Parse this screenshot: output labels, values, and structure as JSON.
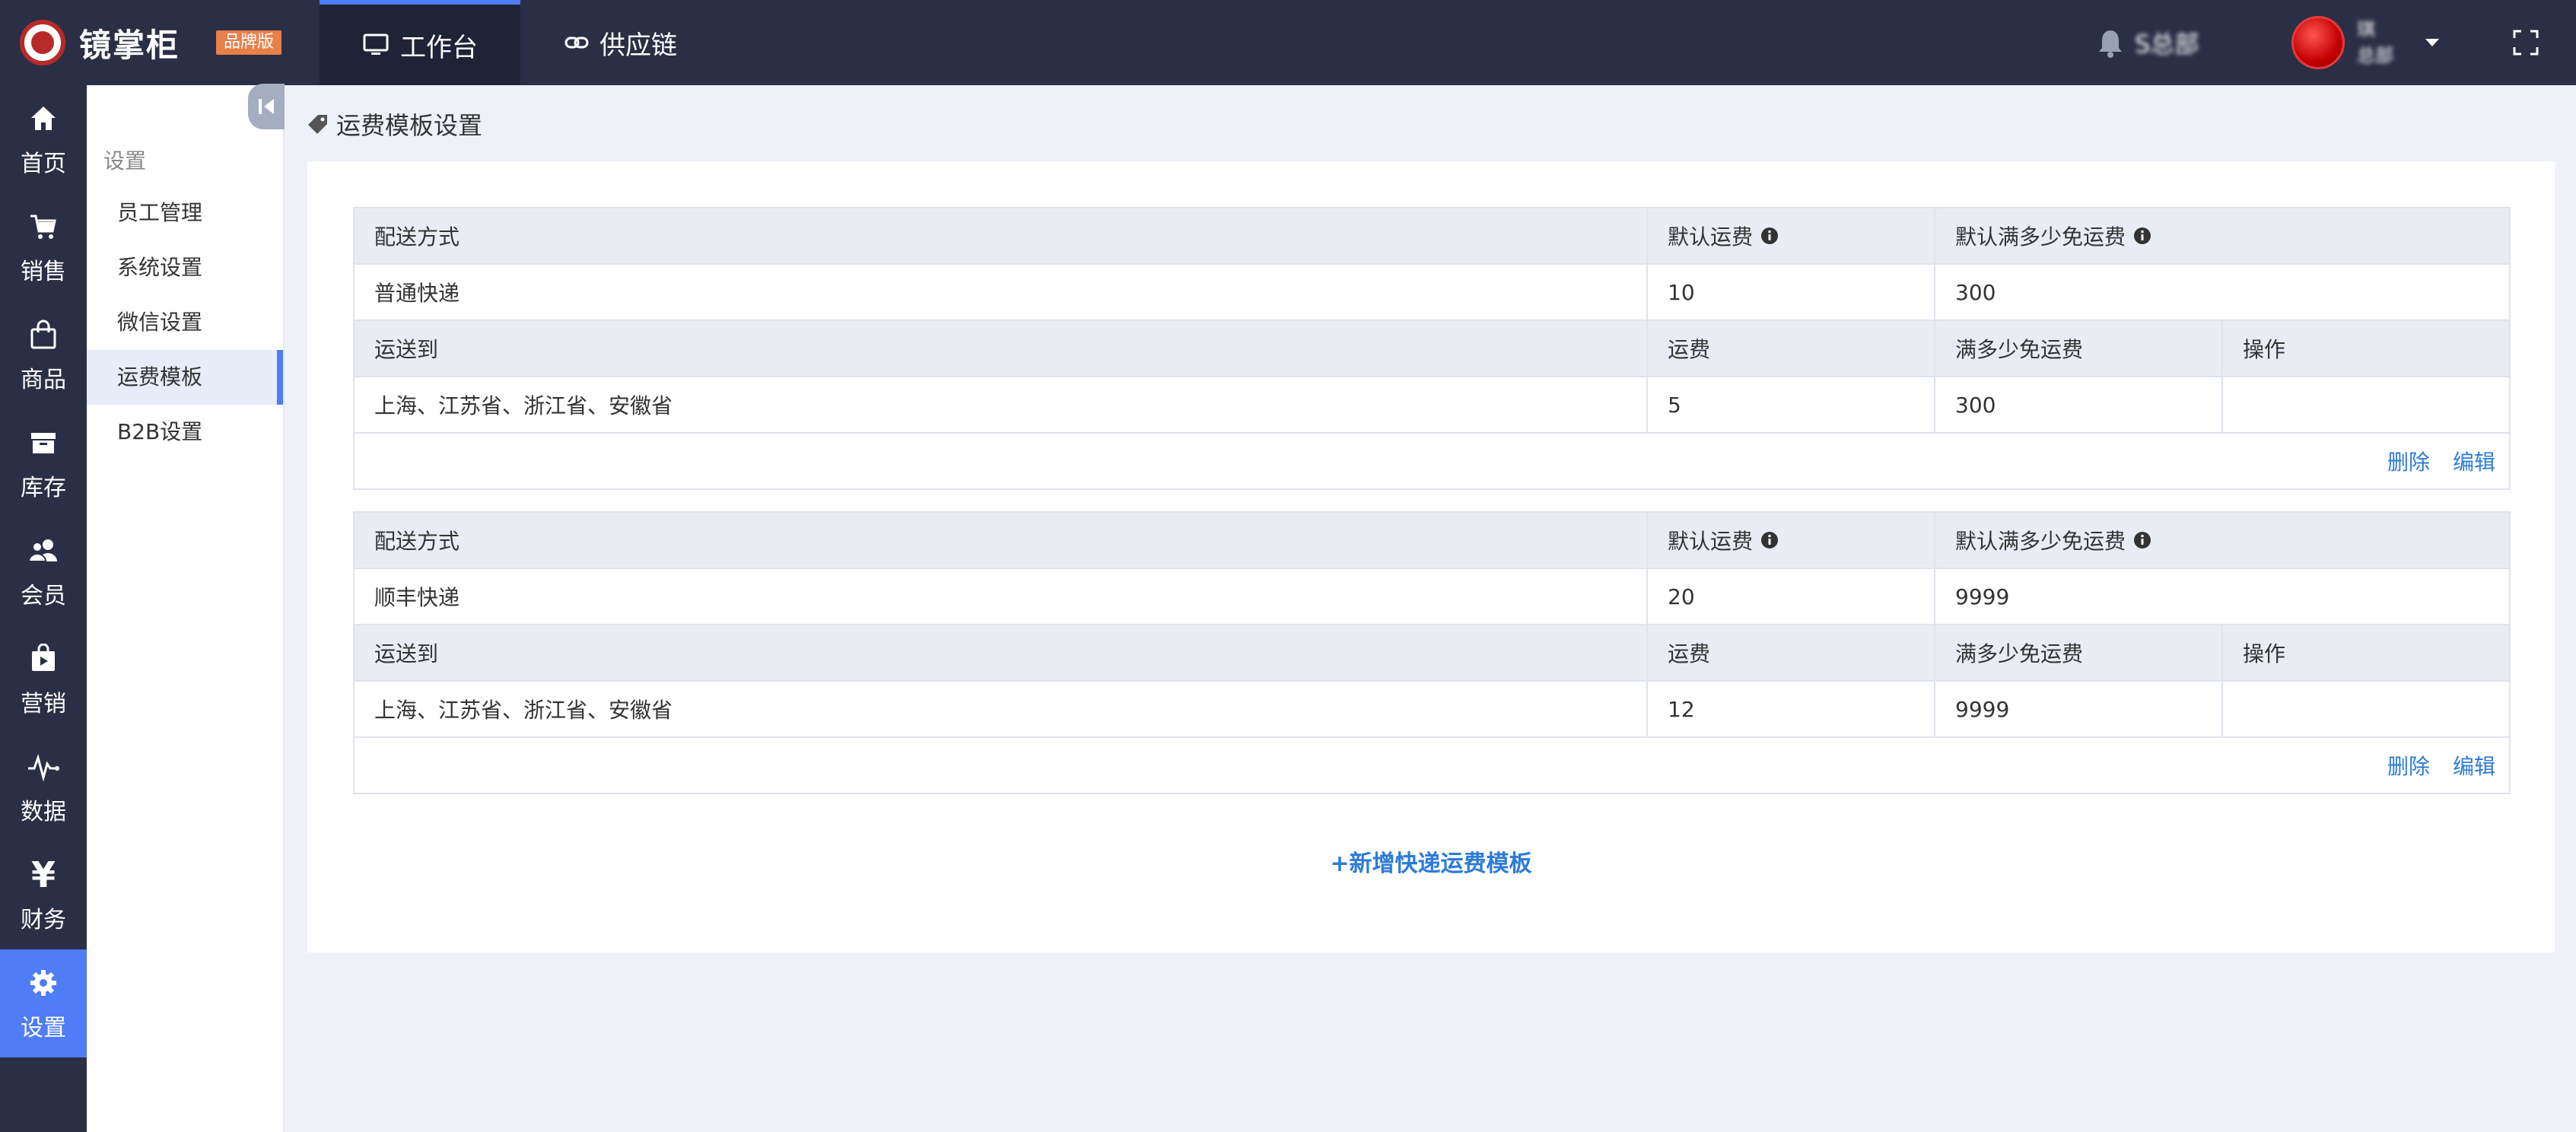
{
  "app": {
    "name": "镜掌柜",
    "badge": "品牌版"
  },
  "topnav": {
    "tabs": [
      {
        "label": "工作台",
        "icon": "monitor-icon"
      },
      {
        "label": "供应链",
        "icon": "link-icon"
      }
    ],
    "org_name": "S总部",
    "user_name": "琪",
    "user_org": "总部"
  },
  "sidebar": {
    "items": [
      {
        "label": "首页",
        "icon": "home-icon"
      },
      {
        "label": "销售",
        "icon": "cart-icon"
      },
      {
        "label": "商品",
        "icon": "bag-icon"
      },
      {
        "label": "库存",
        "icon": "box-icon"
      },
      {
        "label": "会员",
        "icon": "users-icon"
      },
      {
        "label": "营销",
        "icon": "promotion-icon"
      },
      {
        "label": "数据",
        "icon": "pulse-icon"
      },
      {
        "label": "财务",
        "icon": "yen-icon"
      },
      {
        "label": "设置",
        "icon": "gear-icon"
      }
    ]
  },
  "submenu": {
    "title": "设置",
    "items": [
      "员工管理",
      "系统设置",
      "微信设置",
      "运费模板",
      "B2B设置"
    ]
  },
  "page": {
    "title": "运费模板设置"
  },
  "labels": {
    "delivery_method": "配送方式",
    "default_fee": "默认运费",
    "default_free_threshold": "默认满多少免运费",
    "ship_to": "运送到",
    "fee": "运费",
    "free_threshold": "满多少免运费",
    "operation": "操作",
    "delete": "删除",
    "edit": "编辑"
  },
  "templates": [
    {
      "method": "普通快递",
      "default_fee": "10",
      "default_free": "300",
      "region": "上海、江苏省、浙江省、安徽省",
      "fee": "5",
      "free": "300"
    },
    {
      "method": "顺丰快递",
      "default_fee": "20",
      "default_free": "9999",
      "region": "上海、江苏省、浙江省、安徽省",
      "fee": "12",
      "free": "9999"
    }
  ],
  "add_button": "+新增快递运费模板",
  "colors": {
    "topbar": "#2b2f45",
    "accent": "#4f7cf7",
    "link": "#2d7bd8",
    "badge": "#e8804a"
  }
}
